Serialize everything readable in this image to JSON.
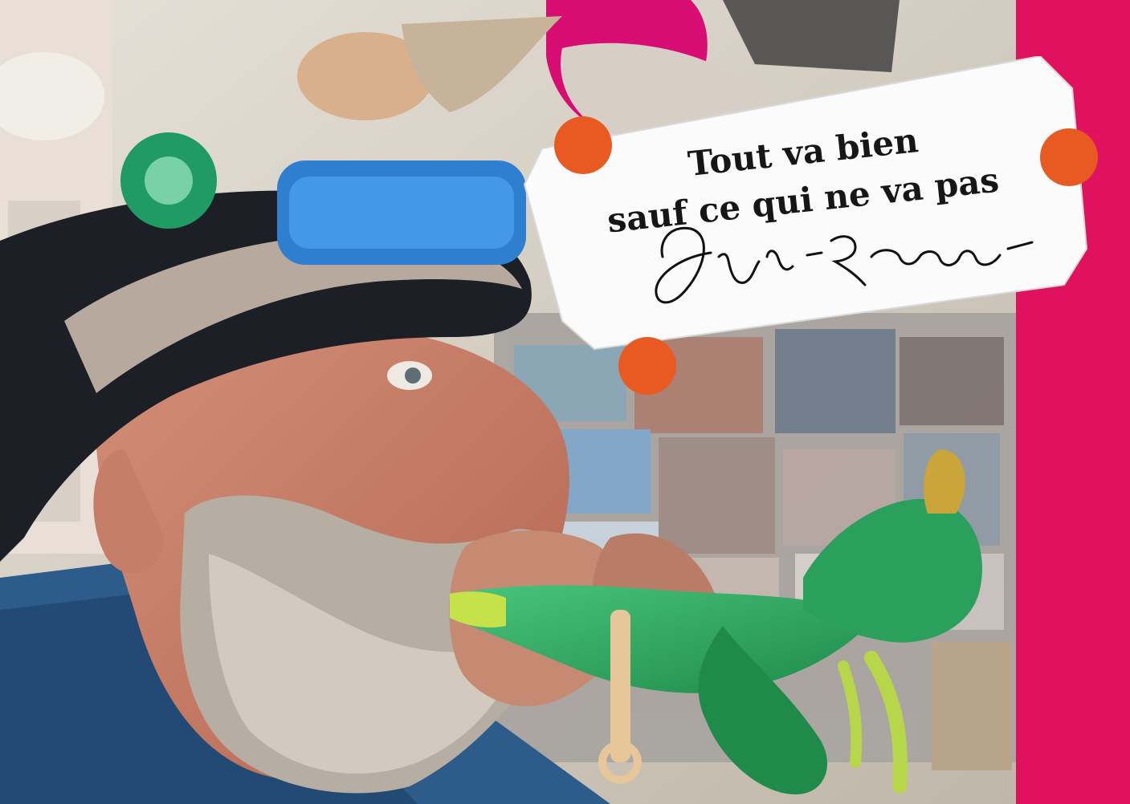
{
  "label": {
    "line1": "Tout va bien",
    "line2": "sauf ce qui ne va pas",
    "signature_text": "Pierre Rosverne"
  },
  "colors": {
    "accent_pink": "#e0115f",
    "dot_orange": "#e85a22",
    "card_white": "#fbfbfb"
  },
  "icons": [
    "signature"
  ]
}
